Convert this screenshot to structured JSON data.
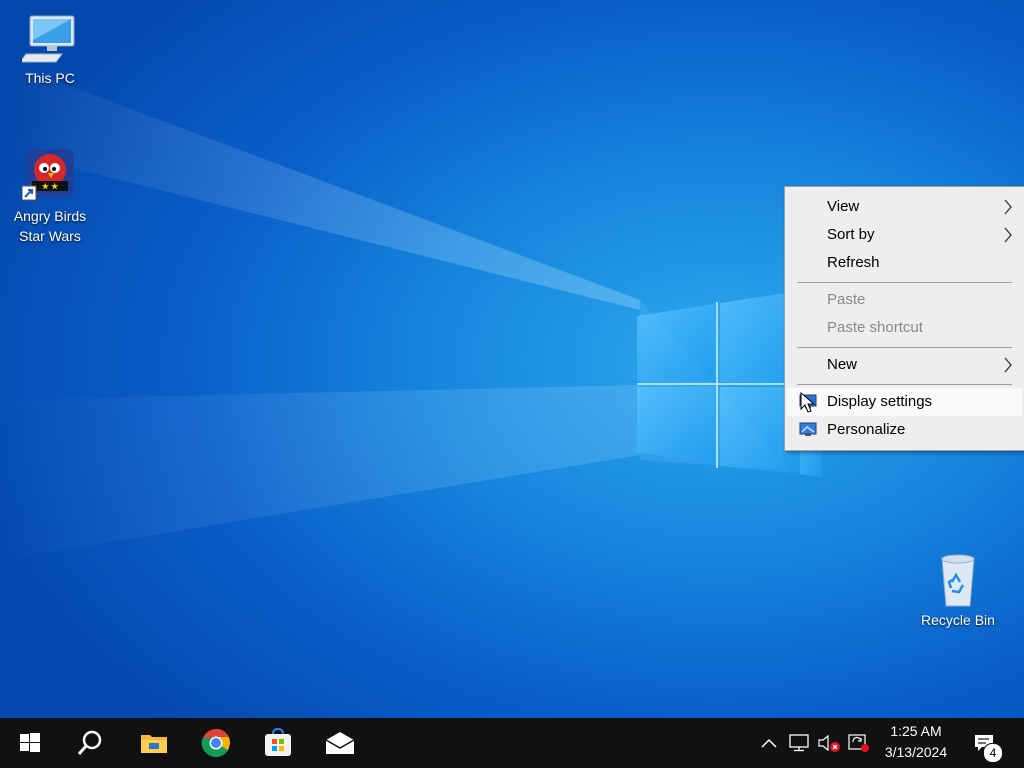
{
  "desktop": {
    "icons": [
      {
        "label": "This PC"
      },
      {
        "label": "Angry Birds Star Wars"
      },
      {
        "label": "Recycle Bin"
      }
    ]
  },
  "context_menu": {
    "items": [
      {
        "label": "View",
        "enabled": true,
        "submenu": true
      },
      {
        "label": "Sort by",
        "enabled": true,
        "submenu": true
      },
      {
        "label": "Refresh",
        "enabled": true,
        "submenu": false
      },
      {
        "label": "Paste",
        "enabled": false,
        "submenu": false
      },
      {
        "label": "Paste shortcut",
        "enabled": false,
        "submenu": false
      },
      {
        "label": "New",
        "enabled": true,
        "submenu": true
      },
      {
        "label": "Display settings",
        "enabled": true,
        "submenu": false,
        "icon": "display-settings-icon",
        "highlighted": true
      },
      {
        "label": "Personalize",
        "enabled": true,
        "submenu": false,
        "icon": "personalize-icon"
      }
    ]
  },
  "taskbar": {
    "pinned": [
      "start-icon",
      "search-icon",
      "file-explorer-icon",
      "chrome-icon",
      "microsoft-store-icon",
      "mail-icon"
    ],
    "tray": [
      "show-hidden-icons-chevron",
      "network-icon",
      "volume-muted-icon",
      "update-icon"
    ],
    "clock": {
      "time": "1:25 AM",
      "date": "3/13/2024"
    },
    "notifications": {
      "count": "4"
    }
  },
  "colors": {
    "desktop_bg": "#0a6fd6",
    "taskbar_bg": "#111114",
    "menu_bg": "#eeeeee",
    "menu_disabled_text": "#8a8a8a"
  }
}
